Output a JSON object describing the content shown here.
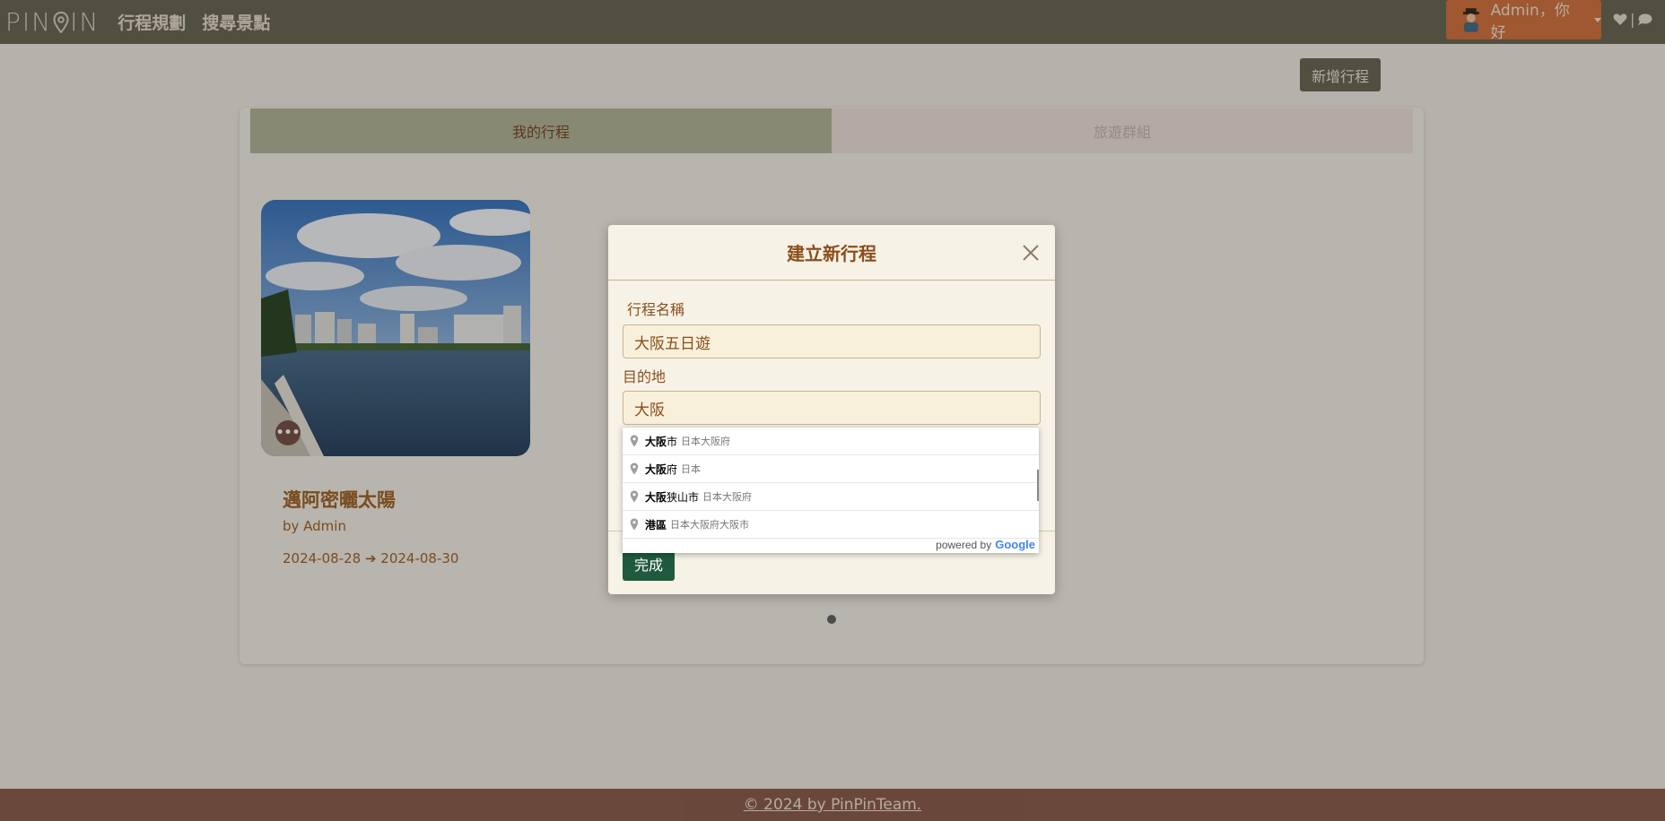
{
  "navbar": {
    "logo": "PINPIN",
    "links": [
      "行程規劃",
      "搜尋景點"
    ],
    "user_label": "Admin，你好"
  },
  "page": {
    "new_trip_button": "新增行程",
    "tabs": [
      {
        "label": "我的行程",
        "active": true
      },
      {
        "label": "旅遊群組",
        "active": false
      }
    ],
    "trip_card": {
      "title": "邁阿密曬太陽",
      "author": "by Admin",
      "dates": "2024-08-28 ➔ 2024-08-30",
      "more_label": "•••"
    }
  },
  "modal": {
    "title": "建立新行程",
    "name_label": "行程名稱",
    "name_value": "大阪五日遊",
    "destination_label": "目的地",
    "destination_value": "大阪",
    "done_button": "完成"
  },
  "autocomplete": {
    "items": [
      {
        "main": "大阪",
        "rest": "市",
        "secondary": "日本大阪府"
      },
      {
        "main": "大阪",
        "rest": "府",
        "secondary": "日本"
      },
      {
        "main": "大阪",
        "rest": "狭山市",
        "secondary": "日本大阪府"
      },
      {
        "main": "港區",
        "rest": "",
        "secondary": "日本大阪府大阪市"
      }
    ],
    "powered_by": "powered by",
    "google": "Google"
  },
  "footer": {
    "text": "© 2024 by PinPinTeam."
  },
  "colors": {
    "navbar": "#6b6a56",
    "accent": "#d4763f",
    "brown_text": "#8a4e1c",
    "done_button": "#1f5a3e",
    "footer": "#8d614f"
  }
}
